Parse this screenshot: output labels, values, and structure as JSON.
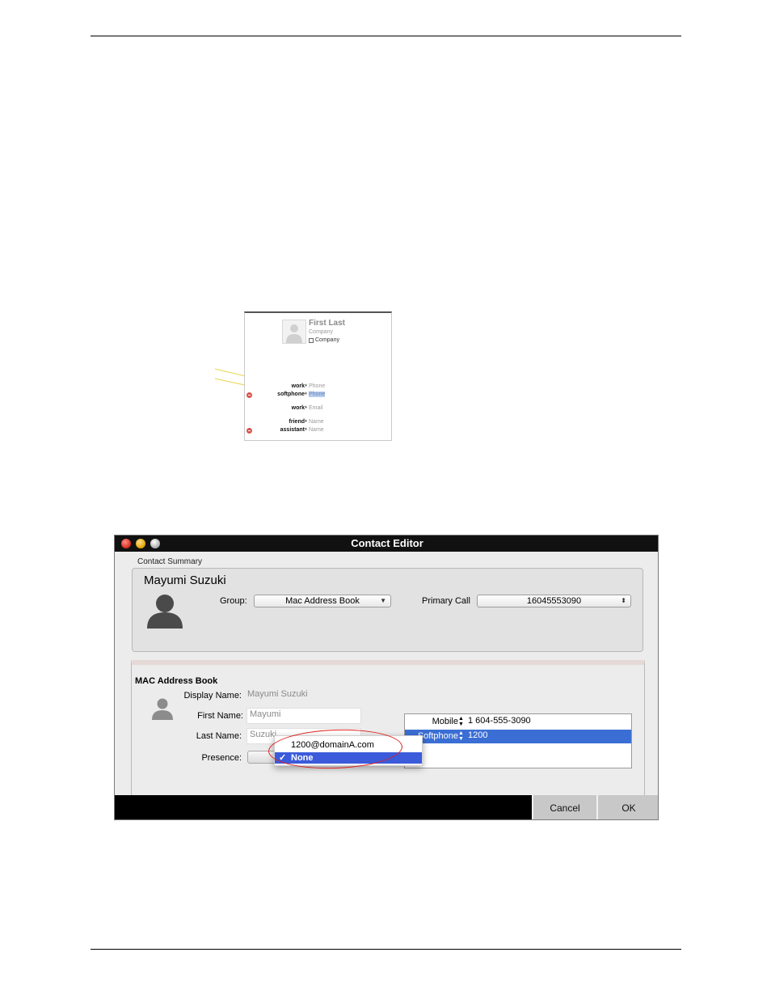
{
  "address_book_card": {
    "name": "First Last",
    "company_placeholder": "Company",
    "company_checkbox_label": "Company",
    "rows": [
      {
        "label": "work",
        "value": "Phone",
        "removable": false,
        "selected": false
      },
      {
        "label": "softphone",
        "value": "Phone",
        "removable": true,
        "selected": true
      },
      {
        "label": "work",
        "value": "Email",
        "removable": false,
        "selected": false
      },
      {
        "label": "friend",
        "value": "Name",
        "removable": false,
        "selected": false
      },
      {
        "label": "assistant",
        "value": "Name",
        "removable": true,
        "selected": false
      }
    ]
  },
  "contact_editor": {
    "window_title": "Contact Editor",
    "summary": {
      "section_label": "Contact Summary",
      "contact_name": "Mayumi Suzuki",
      "group_label": "Group:",
      "group_value": "Mac Address Book",
      "primary_call_label": "Primary Call",
      "primary_call_value": "16045553090"
    },
    "mac_address_book": {
      "title": "MAC Address Book",
      "display_name_label": "Display Name:",
      "display_name_value": "Mayumi Suzuki",
      "first_name_label": "First Name:",
      "first_name_value": "Mayumi",
      "last_name_label": "Last Name:",
      "last_name_value": "Suzuki",
      "presence_label": "Presence:",
      "phones": [
        {
          "type": "Mobile",
          "number": "1 604-555-3090",
          "selected": false
        },
        {
          "type": "Softphone",
          "number": "1200",
          "selected": true
        }
      ]
    },
    "presence_menu": {
      "items": [
        {
          "label": "1200@domainA.com",
          "checked": false
        },
        {
          "label": "None",
          "checked": true
        }
      ],
      "check_glyph": "✓"
    },
    "buttons": {
      "cancel": "Cancel",
      "ok": "OK"
    },
    "colors": {
      "selection": "#3b6ed4",
      "menu_selection": "#3b5bdb",
      "annotation_ring": "#e02020",
      "callout_line": "#e8d44a"
    }
  }
}
